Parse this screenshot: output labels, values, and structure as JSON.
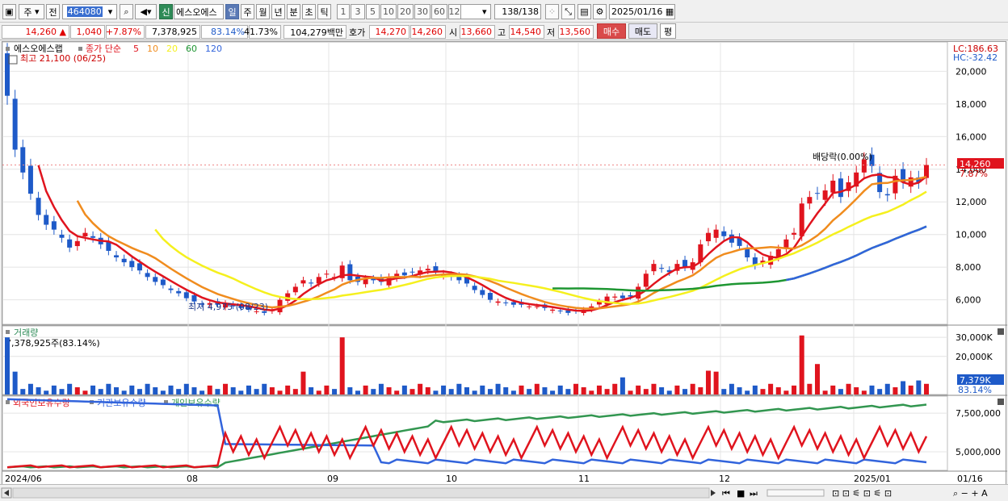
{
  "toolbar": {
    "market": "주",
    "prev": "전",
    "code": "464080",
    "new_label": "신",
    "stock_name": "에스오에스",
    "periods": [
      "일",
      "주",
      "월",
      "년",
      "분",
      "초",
      "틱"
    ],
    "intervals": [
      "1",
      "3",
      "5",
      "10",
      "20",
      "30",
      "60",
      "120"
    ],
    "count": "138",
    "count_total": "/138",
    "date": "2025/01/16"
  },
  "infobar": {
    "price": "14,260",
    "change": "1,040",
    "change_pct": "+7.87%",
    "volume": "7,378,925",
    "vol_ratio": "83.14%",
    "turnover": "41.73%",
    "amount": "104,279백만",
    "quote_label": "호가",
    "ask": "14,270",
    "bid": "14,260",
    "open_label": "시",
    "open": "13,660",
    "high_label": "고",
    "high": "14,540",
    "low_label": "저",
    "low": "13,560",
    "buy": "매수",
    "sell": "매도",
    "avg": "평"
  },
  "legend": {
    "name": "에스오에스랩",
    "ma_label": "종가 단순",
    "ma_periods": [
      "5",
      "10",
      "20",
      "60",
      "120"
    ],
    "max_text": "최고 21,100 (06/25)",
    "min_text": "최저 4,975 (08/23)",
    "dividend": "배당락(0.00%)",
    "lc": "LC:186.63",
    "hc": "HC:-32.42",
    "last_price": "14,260",
    "last_pct": "7.87%",
    "vol_title": "거래량",
    "vol_value": "7,378,925주(83.14%)",
    "vol_last": "7,379K",
    "vol_pct": "83.14%",
    "hold_labels": [
      "외국인보유수량",
      "기관보유수량",
      "개인보유수량"
    ]
  },
  "colors": {
    "up": "#e0141e",
    "down": "#1e5ac8",
    "ma5": "#e0141e",
    "ma10": "#f08c1e",
    "ma20": "#f5f01e",
    "ma60": "#1e9632",
    "ma120": "#3264dc",
    "foreign": "#e0141e",
    "inst": "#3264dc",
    "retail": "#329650"
  },
  "chart_data": [
    {
      "type": "line",
      "title": "에스오에스랩",
      "note": "candlestick price with moving averages",
      "yaxis_ticks": [
        6000,
        8000,
        10000,
        12000,
        14000,
        16000,
        18000,
        20000
      ],
      "ylim": [
        4500,
        21500
      ],
      "xaxis_labels": [
        "2024/06",
        "08",
        "09",
        "10",
        "11",
        "12",
        "2025/01",
        "01/16"
      ],
      "series": [
        {
          "name": "종가",
          "values": [
            18500,
            15200,
            13800,
            12500,
            11200,
            10600,
            10300,
            9800,
            9200,
            9600,
            10100,
            9800,
            9400,
            9000,
            8600,
            8300,
            8000,
            7800,
            7400,
            7100,
            6900,
            6600,
            6400,
            6100,
            5900,
            5700,
            5800,
            5700,
            5800,
            5600,
            5500,
            5400,
            5300,
            5200,
            5400,
            6000,
            6400,
            6800,
            7200,
            7000,
            7400,
            7600,
            7400,
            8100,
            7200,
            7100,
            7300,
            7200,
            7100,
            7400,
            7600,
            7500,
            7700,
            7800,
            7900,
            7700,
            7600,
            7400,
            7200,
            7000,
            6600,
            6300,
            6000,
            5900,
            5800,
            5700,
            5700,
            5600,
            5600,
            5500,
            5400,
            5300,
            5200,
            5300,
            5400,
            5600,
            5900,
            6200,
            6200,
            6100,
            6200,
            6800,
            7600,
            8200,
            7900,
            7700,
            8200,
            8000,
            8300,
            9400,
            10100,
            10300,
            9900,
            9500,
            9300,
            8600,
            8100,
            8400,
            8700,
            9100,
            9700,
            10100,
            11900,
            12300,
            12500,
            12700,
            13300,
            12300,
            13200,
            13800,
            14600,
            14200,
            12600,
            12400,
            13600,
            13200,
            13500,
            13200,
            14260
          ]
        }
      ]
    },
    {
      "type": "bar",
      "title": "거래량",
      "yaxis_ticks": [
        "20,000K",
        "30,000K"
      ],
      "series": [
        {
          "name": "거래량",
          "last": 7379
        }
      ]
    },
    {
      "type": "line",
      "title": "보유수량",
      "yaxis_ticks": [
        "5,000,000",
        "7,500,000"
      ],
      "series": [
        {
          "name": "외국인보유수량"
        },
        {
          "name": "기관보유수량"
        },
        {
          "name": "개인보유수량"
        }
      ]
    }
  ]
}
